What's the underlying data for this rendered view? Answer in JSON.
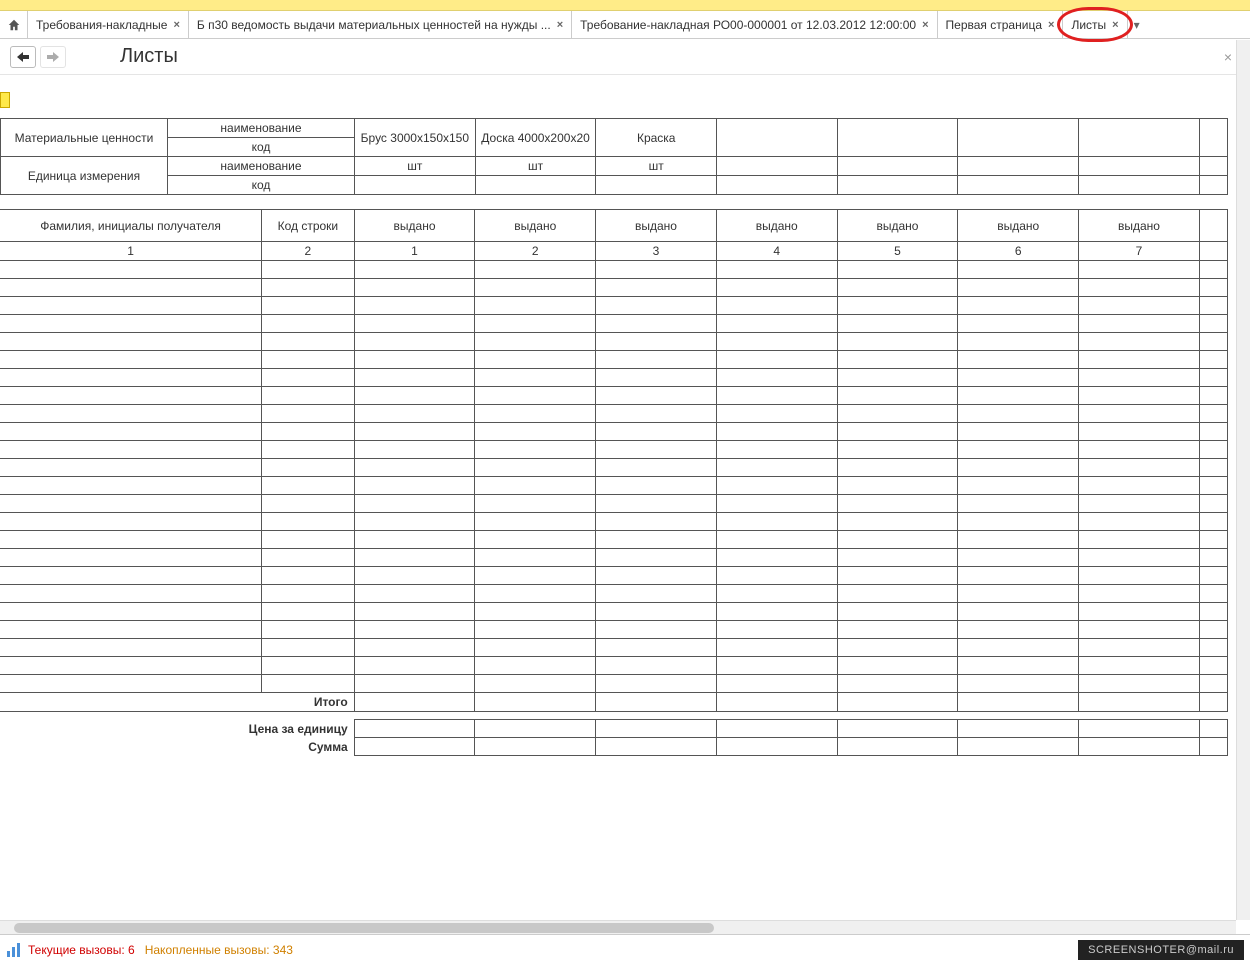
{
  "tabs": [
    {
      "label": "Требования-накладные"
    },
    {
      "label": "Б п30 ведомость выдачи материальных ценностей на нужды ..."
    },
    {
      "label": "Требование-накладная РО00-000001 от 12.03.2012 12:00:00"
    },
    {
      "label": "Первая страница"
    },
    {
      "label": "Листы"
    }
  ],
  "page_title": "Листы",
  "header": {
    "mat_values": "Материальные ценности",
    "name": "наименование",
    "code": "код",
    "unit": "Единица измерения",
    "items": [
      {
        "name": "Брус 3000x150x150",
        "unit": "шт"
      },
      {
        "name": "Доска 4000x200x20",
        "unit": "шт"
      },
      {
        "name": "Краска",
        "unit": "шт"
      }
    ]
  },
  "columns": {
    "recipient": "Фамилия, инициалы получателя",
    "row_code": "Код строки",
    "issued": "выдано",
    "nums": [
      "1",
      "2",
      "1",
      "2",
      "3",
      "4",
      "5",
      "6",
      "7"
    ]
  },
  "footer": {
    "total": "Итого",
    "price": "Цена за единицу",
    "sum": "Сумма"
  },
  "status": {
    "current_label": "Текущие вызовы:",
    "current_val": "6",
    "accum_label": "Накопленные вызовы:",
    "accum_val": "343",
    "watermark": "SCREENSHOTER@mail.ru"
  }
}
